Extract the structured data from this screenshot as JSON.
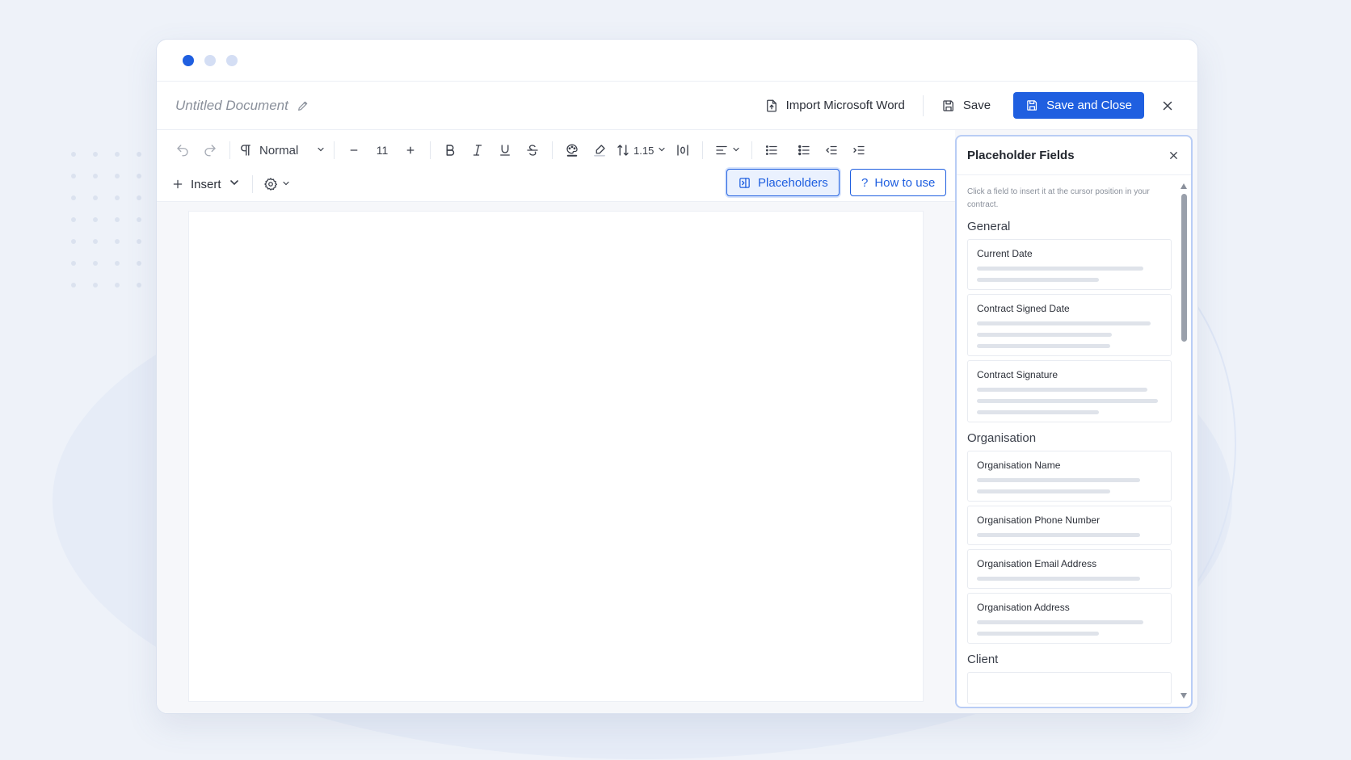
{
  "window": {
    "doc_title": "Untitled Document"
  },
  "docbar": {
    "import_label": "Import Microsoft Word",
    "save_label": "Save",
    "save_close_label": "Save and Close"
  },
  "toolbar": {
    "paragraph_style": "Normal",
    "font_size": "11",
    "line_height": "1.15",
    "insert_label": "Insert",
    "placeholders_label": "Placeholders",
    "how_to_use_label": "How to use"
  },
  "panel": {
    "title": "Placeholder Fields",
    "hint": "Click a field to insert it at the cursor position in your contract.",
    "groups": [
      {
        "title": "General",
        "fields": [
          {
            "name": "Current Date",
            "lines": [
              0.9,
              0.66
            ]
          },
          {
            "name": "Contract Signed Date",
            "lines": [
              0.94,
              0.73,
              0.72
            ]
          },
          {
            "name": "Contract Signature",
            "lines": [
              0.92,
              0.98,
              0.66
            ]
          }
        ]
      },
      {
        "title": "Organisation",
        "fields": [
          {
            "name": "Organisation Name",
            "lines": [
              0.88,
              0.72
            ]
          },
          {
            "name": "Organisation Phone Number",
            "lines": [
              0.88
            ]
          },
          {
            "name": "Organisation Email Address",
            "lines": [
              0.88
            ]
          },
          {
            "name": "Organisation Address",
            "lines": [
              0.9,
              0.66
            ]
          }
        ]
      },
      {
        "title": "Client",
        "fields": []
      }
    ]
  },
  "colors": {
    "accent": "#1f5fe0",
    "panel_border": "#b9cdf5",
    "background": "#eef2f9"
  }
}
